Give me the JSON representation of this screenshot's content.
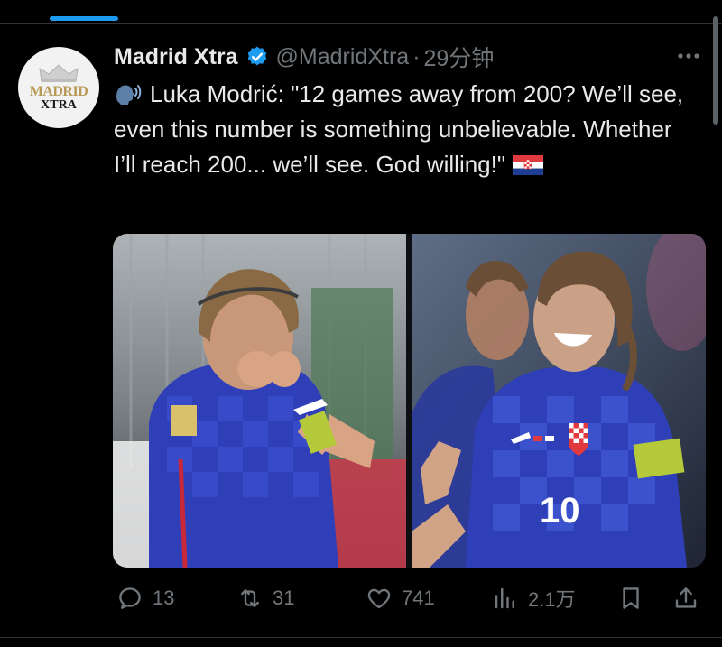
{
  "tweet": {
    "author_name": "Madrid Xtra",
    "handle": "@MadridXtra",
    "separator": "·",
    "time": "29分钟",
    "avatar_logo_top": "MADRID",
    "avatar_logo_bottom": "XTRA",
    "text": "Luka Modrić: \"12 games away from 200? We’ll see, even this number is something unbelievable. Whether I’ll reach 200... we’ll see. God willing!\"",
    "text_prefix_icon": "speaking-head-icon",
    "text_suffix_icon": "croatia-flag-icon"
  },
  "media": {
    "photo_left": {
      "shirt_badge": "",
      "armband": ""
    },
    "photo_right": {
      "shirt_number": "10"
    }
  },
  "actions": {
    "replies": "13",
    "retweets": "31",
    "likes": "741",
    "views": "2.1万"
  },
  "colors": {
    "background": "#000000",
    "primary_text": "#e7e9ea",
    "secondary_text": "#71767b",
    "accent": "#1d9bf0",
    "croatia_blue": "#1c2fb5"
  }
}
